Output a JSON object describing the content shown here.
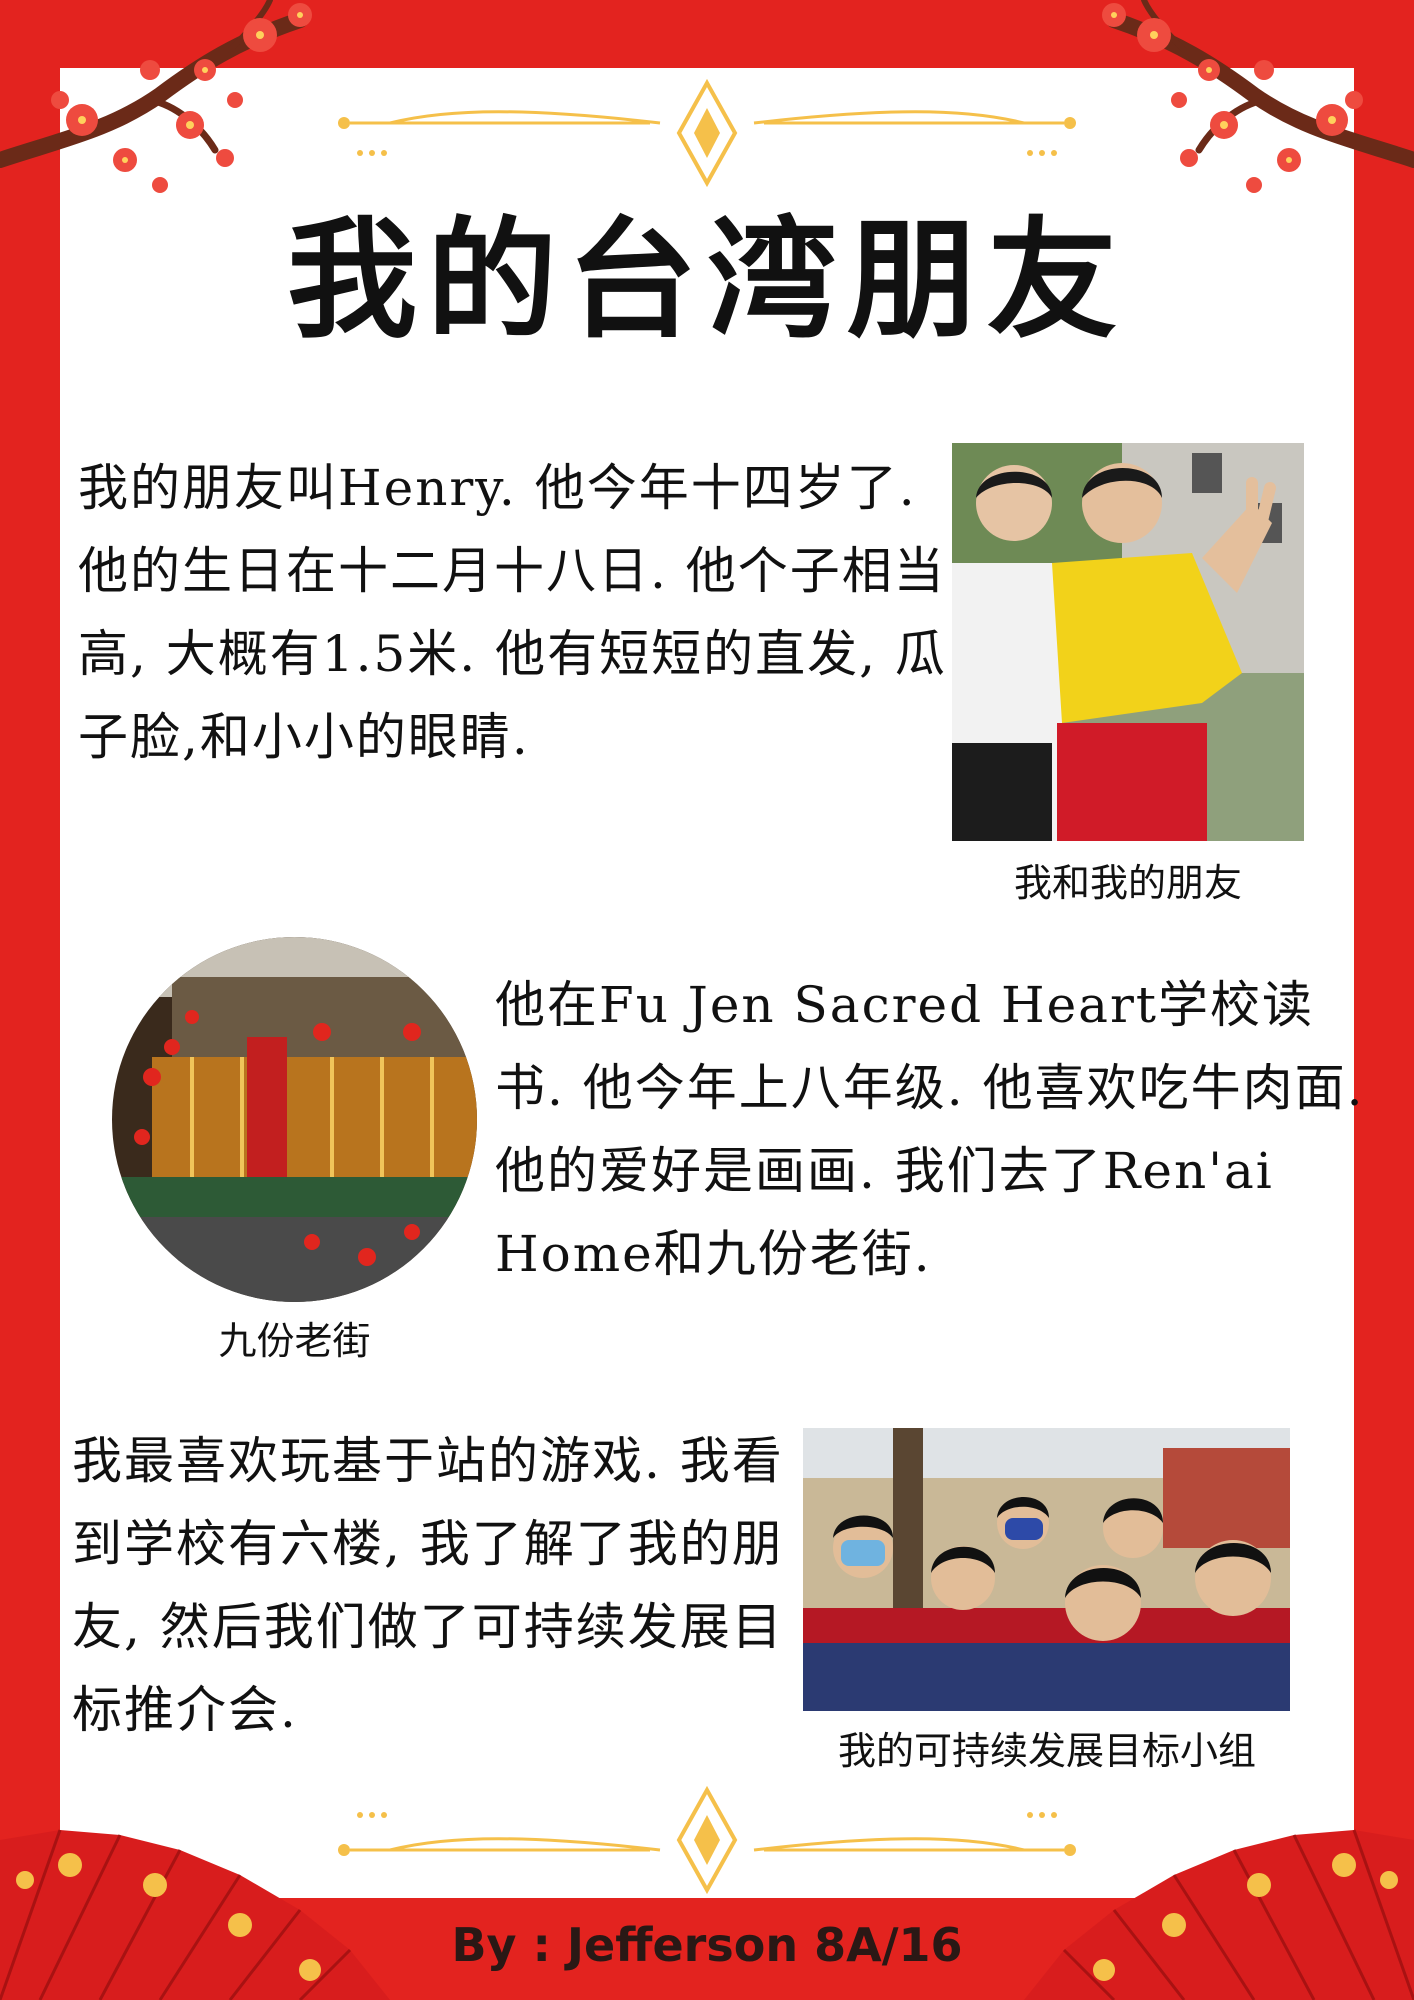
{
  "title": "我的台湾朋友",
  "paragraphs": {
    "p1": "我的朋友叫Henry. 他今年十四岁了. 他的生日在十二月十八日. 他个子相当高, 大概有1.5米. 他有短短的直发, 瓜子脸,和小小的眼睛.",
    "p2": "他在Fu Jen Sacred Heart学校读书. 他今年上八年级. 他喜欢吃牛肉面. 他的爱好是画画. 我们去了Ren'ai Home和九份老街.",
    "p3": "我最喜欢玩基于站的游戏. 我看到学校有六楼, 我了解了我的朋友, 然后我们做了可持续发展目标推介会."
  },
  "captions": {
    "photo1": "我和我的朋友",
    "photo2": "九份老街",
    "photo3": "我的可持续发展目标小组"
  },
  "byline": "By : Jefferson 8A/16",
  "colors": {
    "border_red": "#e3231f",
    "gold": "#f5c04a",
    "blossom": "#ee4b3f",
    "branch": "#6b2a18"
  },
  "icons": {
    "top_ornament": "gold-divider-ornament",
    "bottom_ornament": "gold-divider-ornament",
    "corner_decor": "plum-blossom-branch",
    "bottom_decor": "red-paper-fan"
  }
}
